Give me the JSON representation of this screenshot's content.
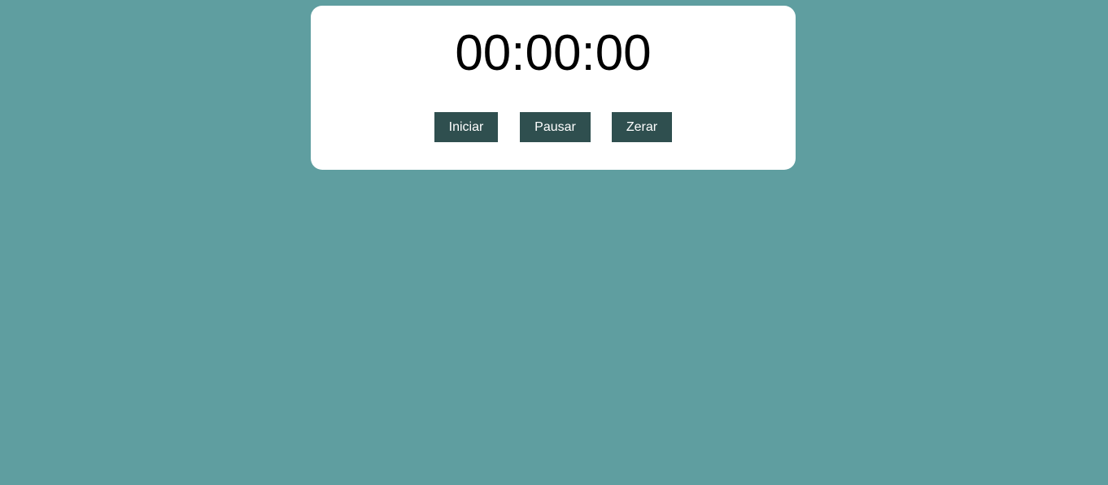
{
  "timer": {
    "display": "00:00:00"
  },
  "controls": {
    "start_label": "Iniciar",
    "pause_label": "Pausar",
    "reset_label": "Zerar"
  },
  "colors": {
    "page_background": "#5f9ea0",
    "card_background": "#ffffff",
    "button_background": "#2f4f4f",
    "button_text": "#ffffff",
    "timer_text": "#000000"
  }
}
